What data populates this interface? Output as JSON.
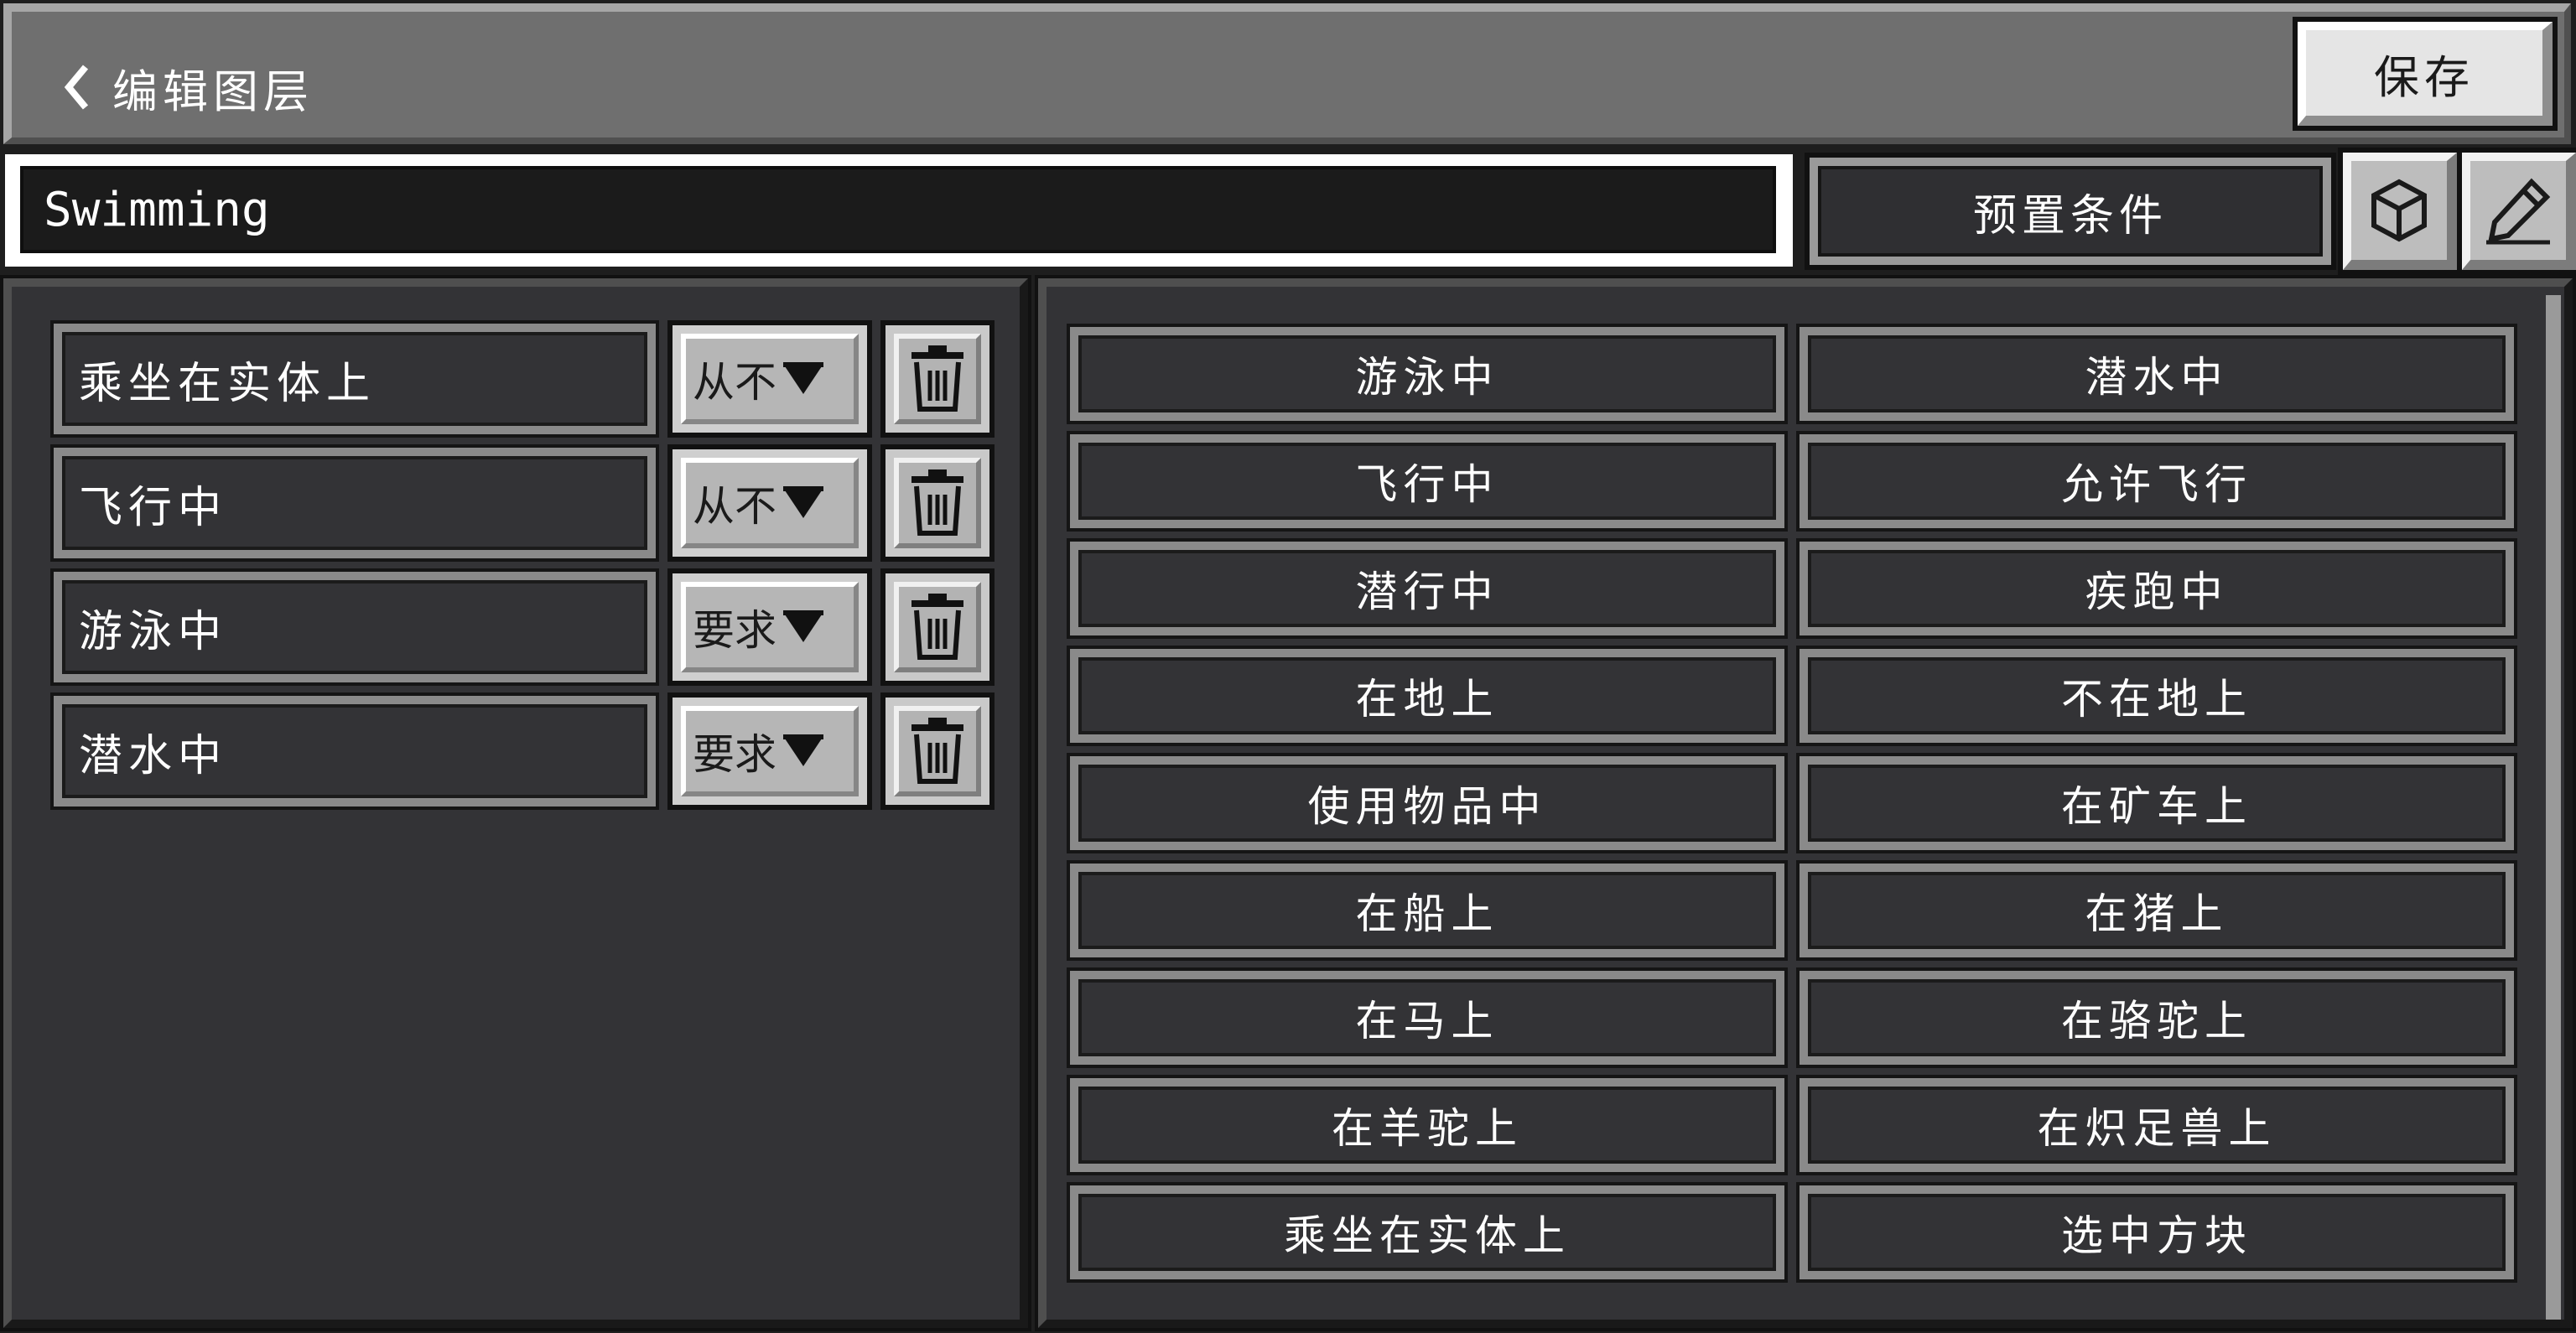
{
  "header": {
    "title": "编辑图层",
    "save_label": "保存"
  },
  "name_field": {
    "value": "Swimming"
  },
  "toolbar": {
    "preset_label": "预置条件",
    "cube_icon": "cube-icon",
    "pencil_icon": "pencil-icon"
  },
  "conditions": [
    {
      "label": "乘坐在实体上",
      "mode": "从不"
    },
    {
      "label": "飞行中",
      "mode": "从不"
    },
    {
      "label": "游泳中",
      "mode": "要求"
    },
    {
      "label": "潜水中",
      "mode": "要求"
    }
  ],
  "available_conditions": [
    "游泳中",
    "潜水中",
    "飞行中",
    "允许飞行",
    "潜行中",
    "疾跑中",
    "在地上",
    "不在地上",
    "使用物品中",
    "在矿车上",
    "在船上",
    "在猪上",
    "在马上",
    "在骆驼上",
    "在羊驼上",
    "在炽足兽上",
    "乘坐在实体上",
    "选中方块"
  ],
  "colors": {
    "panel_bg": "#333336",
    "header_bg": "#6f6f6f",
    "button_light": "#e5e5e5"
  }
}
